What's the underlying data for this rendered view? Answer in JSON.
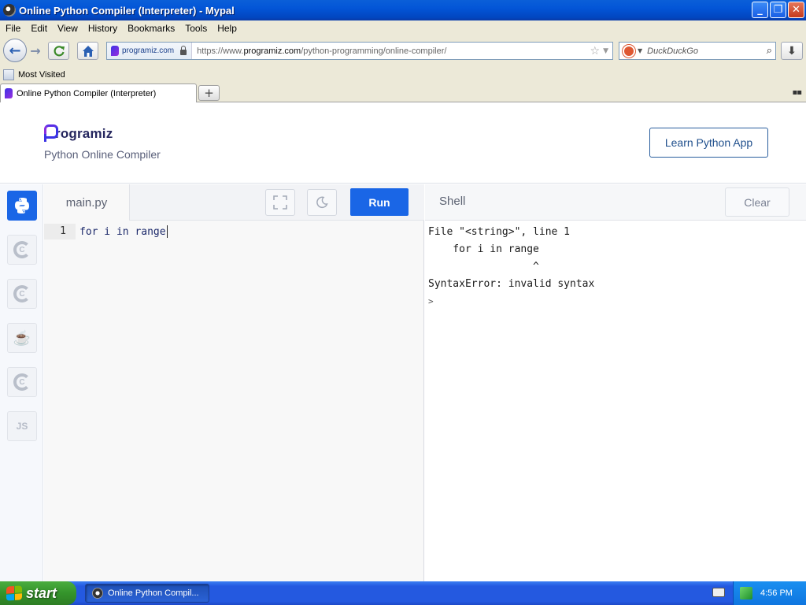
{
  "window": {
    "title": "Online Python Compiler (Interpreter) - Mypal",
    "buttons": {
      "minimize": "_",
      "maximize": "❐",
      "close": "✕"
    }
  },
  "menu": [
    "File",
    "Edit",
    "View",
    "History",
    "Bookmarks",
    "Tools",
    "Help"
  ],
  "navbar": {
    "identity": "programiz.com",
    "url_prefix": "https://www.",
    "url_domain": "programiz.com",
    "url_path": "/python-programming/online-compiler/",
    "search_placeholder": "DuckDuckGo"
  },
  "bookmarks": {
    "most_visited": "Most Visited"
  },
  "tabs": [
    {
      "label": "Online Python Compiler (Interpreter)"
    }
  ],
  "newtab_label": "+",
  "site": {
    "brand": "rogramiz",
    "subtitle": "Python Online Compiler",
    "learn_button": "Learn Python App"
  },
  "sidebar": {
    "languages": [
      {
        "name": "python-icon",
        "label": ""
      },
      {
        "name": "c-icon",
        "label": "C"
      },
      {
        "name": "cpp-icon",
        "label": "C"
      },
      {
        "name": "java-icon",
        "label": "☕"
      },
      {
        "name": "csharp-icon",
        "label": "C"
      },
      {
        "name": "javascript-icon",
        "label": "JS"
      }
    ]
  },
  "editor": {
    "filename": "main.py",
    "run_label": "Run",
    "line_number": "1",
    "code": "for i in range"
  },
  "shell": {
    "title": "Shell",
    "clear_label": "Clear",
    "output": [
      "File \"<string>\", line 1",
      "    for i in range",
      "                 ^",
      "SyntaxError: invalid syntax"
    ],
    "prompt": ">"
  },
  "taskbar": {
    "start_label": "start",
    "task_label": "Online Python Compil...",
    "clock": "4:56 PM"
  }
}
